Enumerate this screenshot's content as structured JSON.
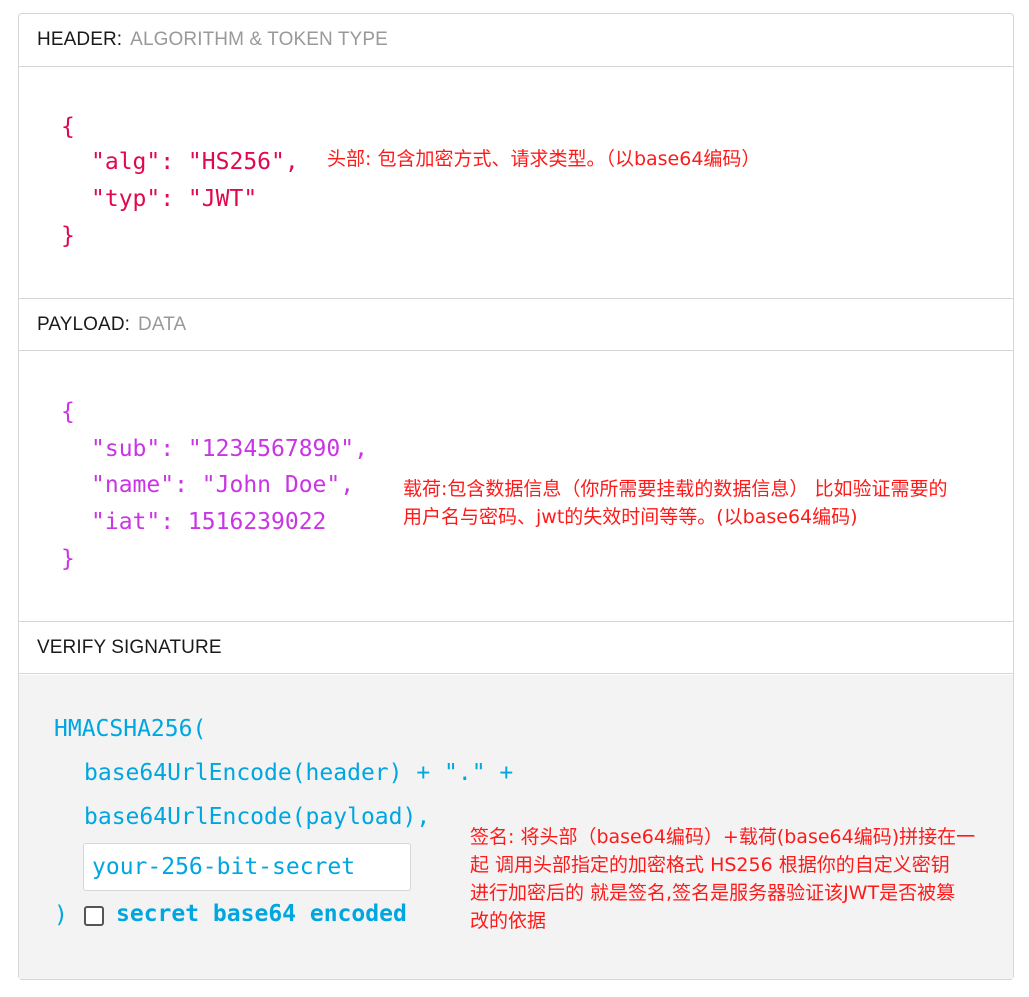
{
  "header": {
    "title": "HEADER:",
    "subtitle": "ALGORITHM & TOKEN TYPE",
    "code": {
      "open": "{",
      "alg_line": "\"alg\": \"HS256\",",
      "typ_line": "\"typ\": \"JWT\"",
      "close": "}"
    },
    "note": "头部: 包含加密方式、请求类型。（以base64编码）"
  },
  "payload": {
    "title": "PAYLOAD:",
    "subtitle": "DATA",
    "code": {
      "open": "{",
      "sub_line": "\"sub\": \"1234567890\",",
      "name_line": "\"name\": \"John Doe\",",
      "iat_line": "\"iat\": 1516239022",
      "close": "}"
    },
    "note_line1": "载荷:包含数据信息（你所需要挂载的数据信息） 比如验证需要的",
    "note_line2": "用户名与密码、jwt的失效时间等等。(以base64编码)"
  },
  "signature": {
    "title": "VERIFY SIGNATURE",
    "code": {
      "fn_open": "HMACSHA256(",
      "line1": "base64UrlEncode(header) + \".\" +",
      "line2": "base64UrlEncode(payload),",
      "close": ")"
    },
    "secret_placeholder": "your-256-bit-secret",
    "checkbox_label": "secret base64 encoded",
    "checkbox_checked": false,
    "note_line1": "签名: 将头部（base64编码）+载荷(base64编码)拼接在一",
    "note_line2": "起 调用头部指定的加密格式 HS256 根据你的自定义密钥",
    "note_line3": "进行加密后的  就是签名,签名是服务器验证该JWT是否被篡",
    "note_line4": "改的依据"
  },
  "colors": {
    "header_code": "#e0094e",
    "payload_code": "#c935e4",
    "signature_code": "#00a6e0",
    "annotation": "#ff1a1a"
  }
}
